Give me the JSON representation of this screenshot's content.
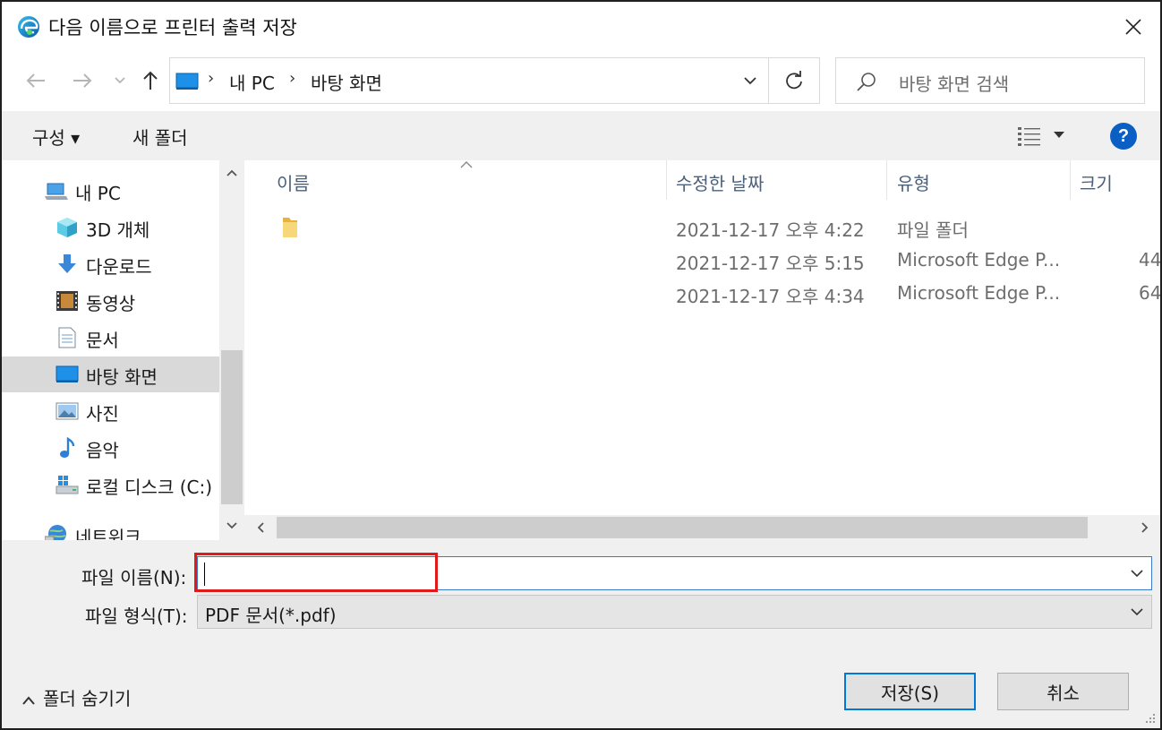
{
  "window": {
    "title": "다음 이름으로 프린터 출력 저장"
  },
  "address": {
    "crumbs": [
      "내 PC",
      "바탕 화면"
    ],
    "separator": "›"
  },
  "search": {
    "placeholder": "바탕 화면 검색"
  },
  "toolbar": {
    "organize_label": "구성 ▾",
    "new_folder_label": "새 폴더",
    "help_label": "?"
  },
  "nav_pane": {
    "items": [
      {
        "label": "내 PC",
        "icon": "computer-icon"
      },
      {
        "label": "3D 개체",
        "icon": "3d-objects-icon"
      },
      {
        "label": "다운로드",
        "icon": "download-icon"
      },
      {
        "label": "동영상",
        "icon": "video-icon"
      },
      {
        "label": "문서",
        "icon": "document-icon"
      },
      {
        "label": "바탕 화면",
        "icon": "desktop-icon",
        "selected": true
      },
      {
        "label": "사진",
        "icon": "pictures-icon"
      },
      {
        "label": "음악",
        "icon": "music-icon"
      },
      {
        "label": "로컬 디스크 (C:)",
        "icon": "disk-icon"
      },
      {
        "label": "네트워크",
        "icon": "network-icon"
      }
    ]
  },
  "file_list": {
    "columns": [
      "이름",
      "수정한 날짜",
      "유형",
      "크기"
    ],
    "rows": [
      {
        "name": "",
        "date": "2021-12-17 오후 4:22",
        "type": "파일 폴더",
        "size": ""
      },
      {
        "name": "",
        "date": "2021-12-17 오후 5:15",
        "type": "Microsoft Edge P...",
        "size": "44"
      },
      {
        "name": "",
        "date": "2021-12-17 오후 4:34",
        "type": "Microsoft Edge P...",
        "size": "64"
      }
    ]
  },
  "form": {
    "filename_label": "파일 이름(N):",
    "filename_value": "",
    "filetype_label": "파일 형식(T):",
    "filetype_value": "PDF 문서(*.pdf)"
  },
  "footer": {
    "hide_folders_label": "폴더 숨기기",
    "save_label": "저장(S)",
    "cancel_label": "취소"
  },
  "colors": {
    "accent": "#0078d7",
    "highlight": "#e11919",
    "selection": "#d9d9d9",
    "help": "#0b5fc4"
  }
}
